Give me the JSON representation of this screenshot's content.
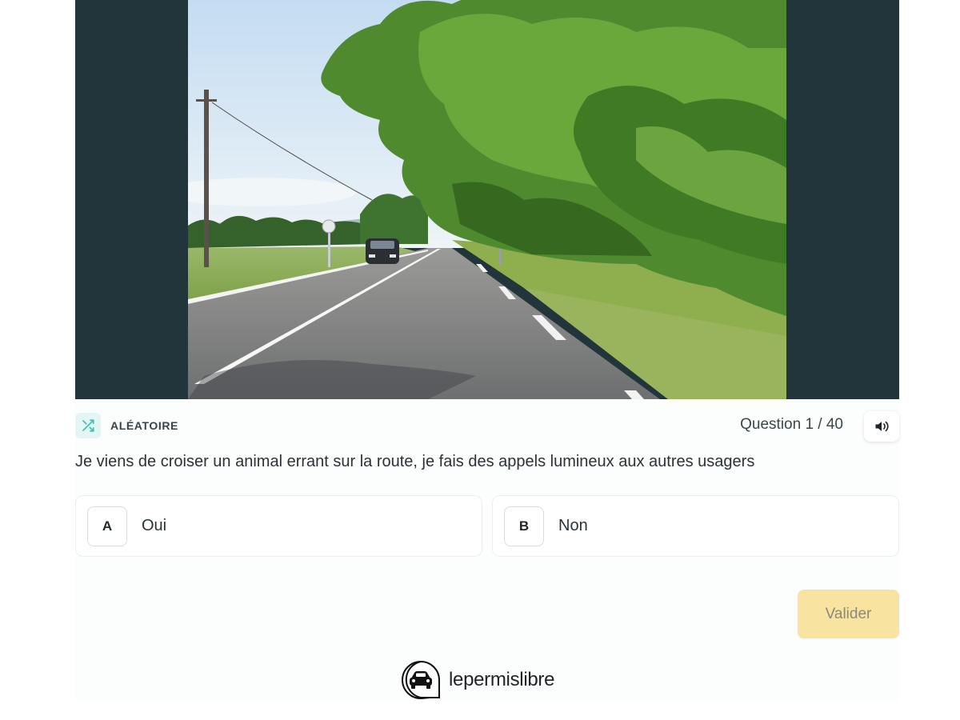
{
  "media": {
    "panel_color": "#22353a"
  },
  "meta": {
    "mode_icon": "shuffle-icon",
    "mode_label": "ALÉATOIRE",
    "counter_text": "Question 1 / 40",
    "audio_icon": "speaker-icon"
  },
  "question": {
    "text": "Je viens de croiser un animal errant sur la route, je fais des appels lumineux aux autres usagers"
  },
  "answers": [
    {
      "key": "A",
      "label": "Oui"
    },
    {
      "key": "B",
      "label": "Non"
    }
  ],
  "actions": {
    "validate_label": "Valider",
    "validate_color": "#f8e3a0"
  },
  "brand": {
    "name": "lepermislibre",
    "logo_icon": "car-icon"
  }
}
